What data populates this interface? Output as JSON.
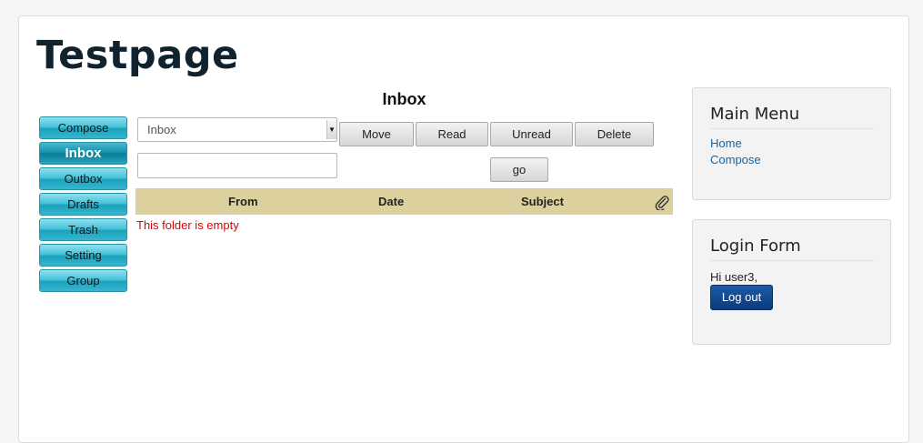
{
  "site": {
    "title": "Testpage"
  },
  "nav": {
    "items": [
      {
        "label": "Compose"
      },
      {
        "label": "Inbox"
      },
      {
        "label": "Outbox"
      },
      {
        "label": "Drafts"
      },
      {
        "label": "Trash"
      },
      {
        "label": "Setting"
      },
      {
        "label": "Group"
      }
    ],
    "active": "Inbox"
  },
  "main": {
    "title": "Inbox",
    "folder_select": {
      "value": "Inbox"
    },
    "actions": {
      "move": "Move",
      "read": "Read",
      "unread": "Unread",
      "delete": "Delete",
      "go": "go"
    },
    "search": {
      "value": ""
    },
    "table": {
      "columns": [
        "From",
        "Date",
        "Subject"
      ],
      "attachment_icon": "paperclip-icon",
      "empty_message": "This folder is empty"
    }
  },
  "main_menu": {
    "title": "Main Menu",
    "links": [
      "Home",
      "Compose"
    ]
  },
  "login_form": {
    "title": "Login Form",
    "greeting": "Hi user3,",
    "logout_label": "Log out"
  },
  "colors": {
    "accent": "#1aa2bd",
    "table_header": "#dcd09e",
    "error_text": "#e00000",
    "link": "#1565a6",
    "logout_button": "#0a3b7c"
  }
}
